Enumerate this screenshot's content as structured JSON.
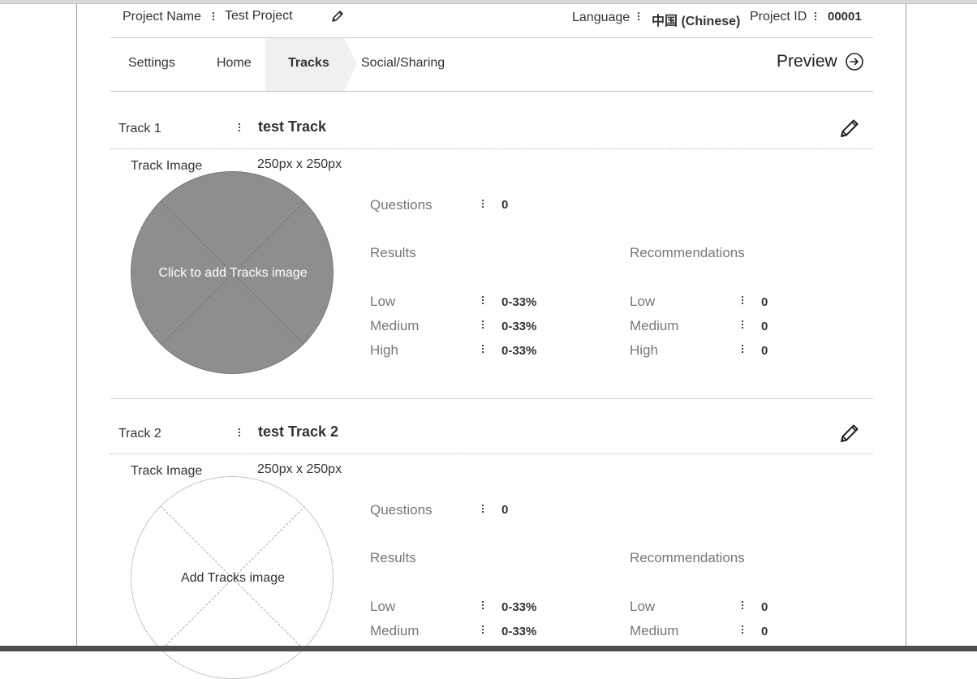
{
  "header": {
    "project_name_label": "Project Name",
    "project_name_value": "Test Project",
    "language_label": "Language",
    "language_value": "中国 (Chinese)",
    "project_id_label": "Project ID",
    "project_id_value": "00001"
  },
  "tabs": [
    {
      "label": "Settings",
      "active": false
    },
    {
      "label": "Home",
      "active": false
    },
    {
      "label": "Tracks",
      "active": true
    },
    {
      "label": "Social/Sharing",
      "active": false
    }
  ],
  "preview_label": "Preview",
  "tracks": [
    {
      "label": "Track 1",
      "name": "test Track",
      "image_label": "Track Image",
      "image_size": "250px x 250px",
      "image_text": "Click to add Tracks image",
      "questions_label": "Questions",
      "questions_value": "0",
      "results_title": "Results",
      "recommendations_title": "Recommendations",
      "results": [
        {
          "label": "Low",
          "value": "0-33%"
        },
        {
          "label": "Medium",
          "value": "0-33%"
        },
        {
          "label": "High",
          "value": "0-33%"
        }
      ],
      "recommendations": [
        {
          "label": "Low",
          "value": "0"
        },
        {
          "label": "Medium",
          "value": "0"
        },
        {
          "label": "High",
          "value": "0"
        }
      ]
    },
    {
      "label": "Track 2",
      "name": "test Track 2",
      "image_label": "Track Image",
      "image_size": "250px x 250px",
      "image_text": "Add Tracks image",
      "questions_label": "Questions",
      "questions_value": "0",
      "results_title": "Results",
      "recommendations_title": "Recommendations",
      "results": [
        {
          "label": "Low",
          "value": "0-33%"
        },
        {
          "label": "Medium",
          "value": "0-33%"
        }
      ],
      "recommendations": [
        {
          "label": "Low",
          "value": "0"
        },
        {
          "label": "Medium",
          "value": "0"
        }
      ]
    }
  ]
}
